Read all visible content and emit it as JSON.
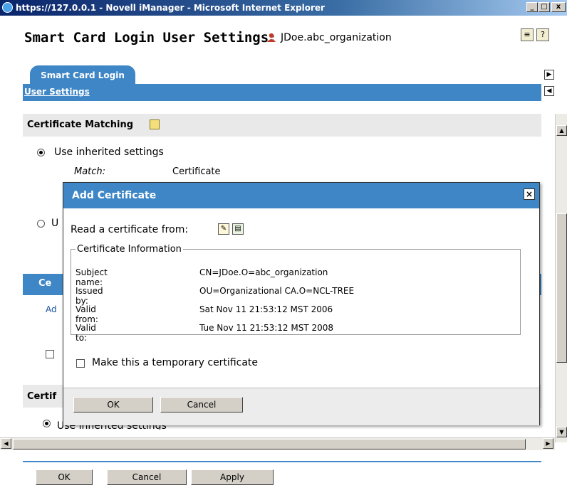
{
  "window": {
    "title": "https://127.0.0.1 - Novell iManager - Microsoft Internet Explorer",
    "min_label": "_",
    "max_label": "□",
    "close_label": "x"
  },
  "header": {
    "title": "Smart Card Login User Settings:",
    "user": "JDoe.abc_organization"
  },
  "tabs": {
    "active_tab": "Smart Card Login",
    "subtab": "User Settings"
  },
  "certificate_matching": {
    "heading": "Certificate Matching",
    "option_inherited": "Use inherited settings",
    "match_label": "Match:",
    "match_value": "Certificate",
    "option_custom_partial": "U"
  },
  "background_partial": {
    "table_header": "Ce",
    "add_link": "Ad",
    "section2_heading": "Certif",
    "section2_option": "Use inherited settings"
  },
  "dialog": {
    "title": "Add Certificate",
    "close": "×",
    "read_from_label": "Read a certificate from:",
    "fieldset_legend": "Certificate Information",
    "rows": [
      {
        "label": "Subject name:",
        "value": "CN=JDoe.O=abc_organization"
      },
      {
        "label": "Issued by:",
        "value": "OU=Organizational CA.O=NCL-TREE"
      },
      {
        "label": "Valid from:",
        "value": "Sat Nov 11 21:53:12 MST 2006"
      },
      {
        "label": "Valid to:",
        "value": "Tue Nov 11 21:53:12 MST 2008"
      }
    ],
    "temp_checkbox_label": "Make this a temporary certificate",
    "ok_label": "OK",
    "cancel_label": "Cancel"
  },
  "footer": {
    "ok_label": "OK",
    "cancel_label": "Cancel",
    "apply_label": "Apply"
  },
  "colors": {
    "accent": "#3e86c6",
    "title_bar": "#0a246a"
  }
}
